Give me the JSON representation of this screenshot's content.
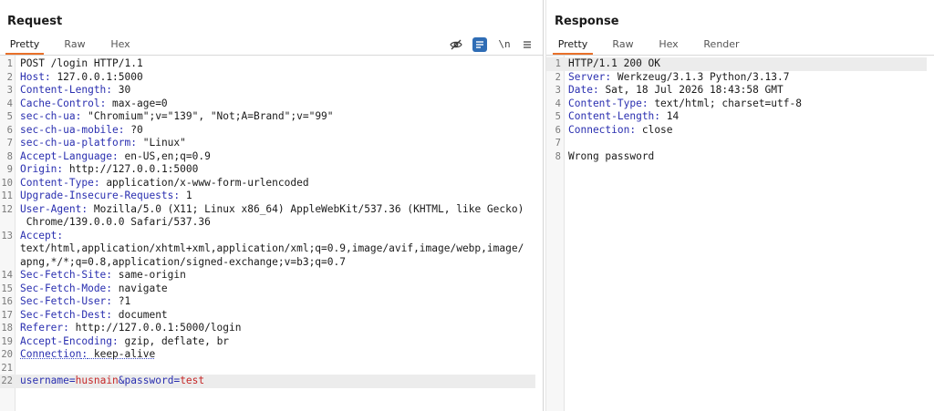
{
  "request": {
    "title": "Request",
    "tabs": [
      "Pretty",
      "Raw",
      "Hex"
    ],
    "tools": {
      "hide_icon": "eye-slash-icon",
      "wrap_icon": "list-icon",
      "newline_label": "\\n",
      "menu_icon": "hamburger-menu-icon"
    },
    "lines": [
      {
        "n": "1",
        "text": "POST /login HTTP/1.1"
      },
      {
        "n": "2",
        "key": "Host",
        "val": " 127.0.0.1:5000"
      },
      {
        "n": "3",
        "key": "Content-Length",
        "val": " 30"
      },
      {
        "n": "4",
        "key": "Cache-Control",
        "val": " max-age=0"
      },
      {
        "n": "5",
        "key": "sec-ch-ua",
        "val": " \"Chromium\";v=\"139\", \"Not;A=Brand\";v=\"99\""
      },
      {
        "n": "6",
        "key": "sec-ch-ua-mobile",
        "val": " ?0"
      },
      {
        "n": "7",
        "key": "sec-ch-ua-platform",
        "val": " \"Linux\""
      },
      {
        "n": "8",
        "key": "Accept-Language",
        "val": " en-US,en;q=0.9"
      },
      {
        "n": "9",
        "key": "Origin",
        "val": " http://127.0.0.1:5000"
      },
      {
        "n": "10",
        "key": "Content-Type",
        "val": " application/x-www-form-urlencoded"
      },
      {
        "n": "11",
        "key": "Upgrade-Insecure-Requests",
        "val": " 1"
      },
      {
        "n": "12",
        "key": "User-Agent",
        "val": " Mozilla/5.0 (X11; Linux x86_64) AppleWebKit/537.36 (KHTML, like Gecko)"
      },
      {
        "n": "",
        "text": " Chrome/139.0.0.0 Safari/537.36"
      },
      {
        "n": "13",
        "key": "Accept",
        "val": ""
      },
      {
        "n": "",
        "text": "text/html,application/xhtml+xml,application/xml;q=0.9,image/avif,image/webp,image/"
      },
      {
        "n": "",
        "text": "apng,*/*;q=0.8,application/signed-exchange;v=b3;q=0.7"
      },
      {
        "n": "14",
        "key": "Sec-Fetch-Site",
        "val": " same-origin"
      },
      {
        "n": "15",
        "key": "Sec-Fetch-Mode",
        "val": " navigate"
      },
      {
        "n": "16",
        "key": "Sec-Fetch-User",
        "val": " ?1"
      },
      {
        "n": "17",
        "key": "Sec-Fetch-Dest",
        "val": " document"
      },
      {
        "n": "18",
        "key": "Referer",
        "val": " http://127.0.0.1:5000/login"
      },
      {
        "n": "19",
        "key": "Accept-Encoding",
        "val": " gzip, deflate, br"
      },
      {
        "n": "20",
        "key": "Connection",
        "val": " keep-alive",
        "dotted": true
      },
      {
        "n": "21",
        "text": ""
      },
      {
        "n": "22",
        "params": [
          {
            "name": "username",
            "value": "husnain"
          },
          {
            "name": "password",
            "value": "test"
          }
        ],
        "highlight": true
      }
    ]
  },
  "response": {
    "title": "Response",
    "tabs": [
      "Pretty",
      "Raw",
      "Hex",
      "Render"
    ],
    "lines": [
      {
        "n": "1",
        "text": "HTTP/1.1 200 OK",
        "highlight": true
      },
      {
        "n": "2",
        "key": "Server",
        "val": " Werkzeug/3.1.3 Python/3.13.7"
      },
      {
        "n": "3",
        "key": "Date",
        "val": " Sat, 18 Jul 2026 18:43:58 GMT"
      },
      {
        "n": "4",
        "key": "Content-Type",
        "val": " text/html; charset=utf-8"
      },
      {
        "n": "5",
        "key": "Content-Length",
        "val": " 14"
      },
      {
        "n": "6",
        "key": "Connection",
        "val": " close"
      },
      {
        "n": "7",
        "text": ""
      },
      {
        "n": "8",
        "text": "Wrong password"
      }
    ]
  },
  "colors": {
    "accent_tab": "#e8702a",
    "header_key": "#2a2fb0",
    "param_value": "#c62828",
    "active_tool": "#2f6db5"
  }
}
